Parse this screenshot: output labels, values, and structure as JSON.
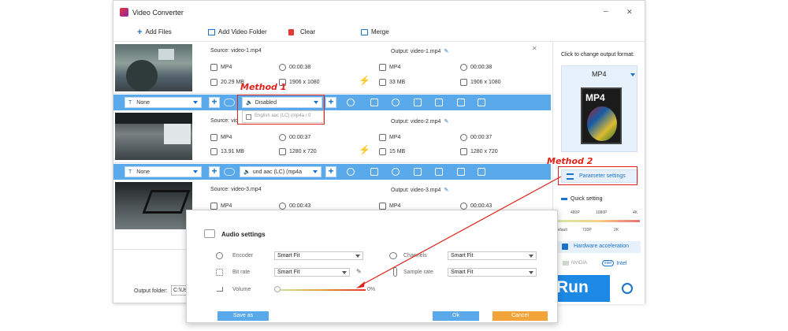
{
  "window": {
    "title": "Video Converter",
    "minimize": "–",
    "close": "✕"
  },
  "toolbar": {
    "add_files": "Add Files",
    "add_folder": "Add Video Folder",
    "clear": "Clear",
    "merge": "Merge"
  },
  "rows": [
    {
      "source": "Source: video-1.mp4",
      "output": "Output: video-1.mp4",
      "src_format": "MP4",
      "src_duration": "00:00:38",
      "src_size": "20.29 MB",
      "src_res": "1906 x 1080",
      "out_format": "MP4",
      "out_duration": "00:00:38",
      "out_size": "33 MB",
      "out_res": "1906 x 1080"
    },
    {
      "source": "Source: vid",
      "output": "Output: video-2.mp4",
      "src_format": "MP4",
      "src_duration": "00:00:37",
      "src_size": "13.91 MB",
      "src_res": "1280 x 720",
      "out_format": "MP4",
      "out_duration": "00:00:37",
      "out_size": "15 MB",
      "out_res": "1280 x 720"
    },
    {
      "source": "Source: video-3.mp4",
      "output": "Output: video-3.mp4",
      "src_format": "MP4",
      "src_duration": "00:00:43",
      "out_format": "MP4",
      "out_duration": "00:00:43"
    }
  ],
  "bar1": {
    "subtitle": "None",
    "audio": "Disabled"
  },
  "bar2": {
    "subtitle": "None",
    "audio": "und aac (LC) (mp4a"
  },
  "audio_dropdown": {
    "option": "English aac (LC) (mp4a / 0"
  },
  "annotations": {
    "method1": "Method 1",
    "method2": "Method 2"
  },
  "side": {
    "click_text": "Click to change output format:",
    "format": "MP4",
    "format_badge": "MP4",
    "param_button": "Parameter settings",
    "quick_setting": "Quick setting",
    "quality_top": [
      "480P",
      "1080P",
      "4K"
    ],
    "quality_bottom": [
      "Default",
      "720P",
      "2K"
    ],
    "hw_accel": "Hardware acceleration",
    "nvidia": "NVIDIA",
    "intel": "Intel",
    "intel_logo": "intel",
    "run": "Run"
  },
  "footer": {
    "output_folder_label": "Output folder:",
    "output_folder_value": "C:\\Us"
  },
  "dialog": {
    "title": "Audio settings",
    "encoder_label": "Encoder",
    "encoder_value": "Smart Fit",
    "channels_label": "Channels",
    "channels_value": "Smart Fit",
    "bitrate_label": "Bit rate",
    "bitrate_value": "Smart Fit",
    "samplerate_label": "Sample rate",
    "samplerate_value": "Smart Fit",
    "volume_label": "Volume",
    "volume_value": "0%",
    "save_as": "Save as",
    "ok": "Ok",
    "cancel": "Cancel"
  },
  "colors": {
    "accent": "#1a73c8",
    "bar": "#5aa9ea",
    "red": "#e0231a",
    "orange": "#f2a33a"
  }
}
